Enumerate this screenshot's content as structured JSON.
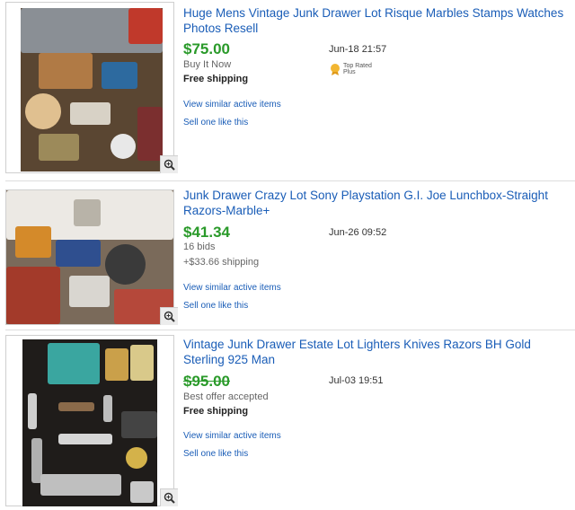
{
  "listings": [
    {
      "title": "Huge Mens Vintage Junk Drawer Lot Risque Marbles Stamps Watches Photos Resell",
      "price": "$75.00",
      "format": "Buy It Now",
      "shipping": "Free shipping",
      "date": "Jun-18 21:57",
      "badge": "Top Rated Plus",
      "link_similar": "View similar active items",
      "link_sell": "Sell one like this"
    },
    {
      "title": "Junk Drawer Crazy Lot Sony Playstation G.I. Joe Lunchbox-Straight Razors-Marble+",
      "price": "$41.34",
      "bids": "16 bids",
      "shipping": "+$33.66 shipping",
      "date": "Jun-26 09:52",
      "link_similar": "View similar active items",
      "link_sell": "Sell one like this"
    },
    {
      "title": "Vintage Junk Drawer Estate Lot Lighters Knives Razors BH Gold Sterling 925 Man",
      "price": "$95.00",
      "status": "Best offer accepted",
      "shipping": "Free shipping",
      "date": "Jul-03 19:51",
      "link_similar": "View similar active items",
      "link_sell": "Sell one like this"
    }
  ],
  "colors": {
    "link": "#1a5db7",
    "price": "#2a9a2a",
    "badge": "#f2b632"
  },
  "icons": {
    "zoom": "magnifier-plus-icon",
    "badge": "top-rated-seal-icon"
  }
}
